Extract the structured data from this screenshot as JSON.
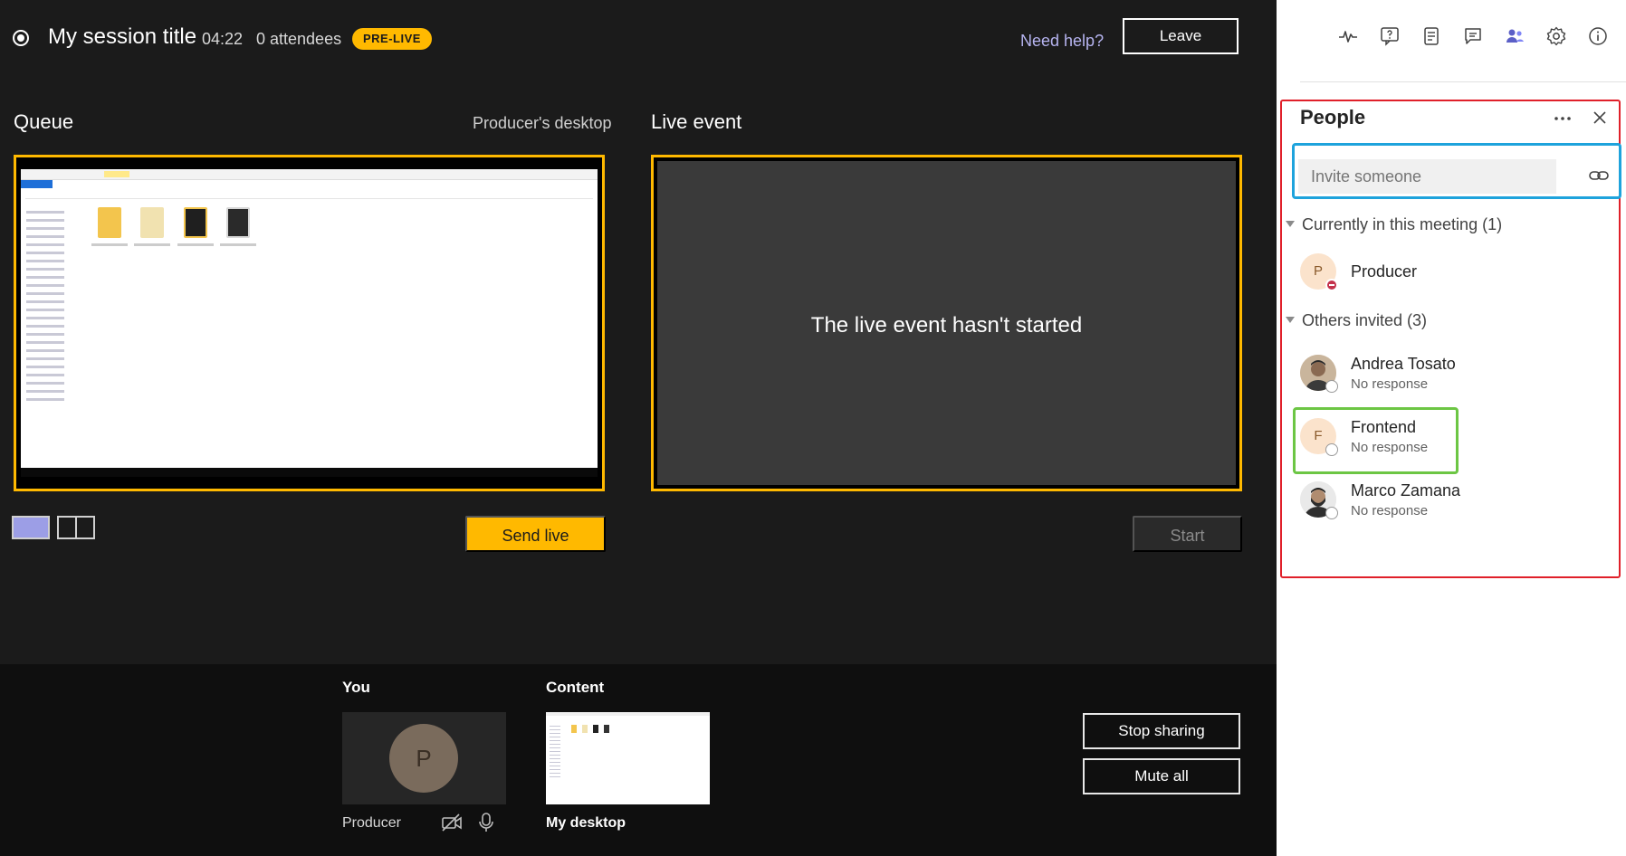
{
  "header": {
    "session_title": "My session title",
    "elapsed": "04:22",
    "attendees": "0 attendees",
    "status_badge": "PRE-LIVE",
    "need_help": "Need help?",
    "leave": "Leave"
  },
  "queue": {
    "title": "Queue",
    "source": "Producer's desktop",
    "send_live": "Send live"
  },
  "live_event": {
    "title": "Live event",
    "message": "The live event hasn't started",
    "start": "Start"
  },
  "tray": {
    "you_label": "You",
    "you_name": "Producer",
    "you_initial": "P",
    "content_label": "Content",
    "content_name": "My desktop",
    "stop_sharing": "Stop sharing",
    "mute_all": "Mute all"
  },
  "side_toolbar": {
    "icons": [
      "activity-icon",
      "qna-icon",
      "notes-icon",
      "chat-icon",
      "people-icon",
      "settings-icon",
      "info-icon"
    ]
  },
  "people_panel": {
    "title": "People",
    "invite_placeholder": "Invite someone",
    "current_group": "Currently in this meeting (1)",
    "invited_group": "Others invited (3)",
    "current": [
      {
        "name": "Producer",
        "initial": "P"
      }
    ],
    "invited": [
      {
        "name": "Andrea Tosato",
        "status": "No response"
      },
      {
        "name": "Frontend",
        "status": "No response",
        "initial": "F"
      },
      {
        "name": "Marco Zamana",
        "status": "No response"
      }
    ]
  },
  "colors": {
    "accent": "#ffb900",
    "stage_bg": "#1b1b1b",
    "highlight_red": "#e0202a",
    "highlight_blue": "#1ea3dc",
    "highlight_green": "#6cc644"
  }
}
